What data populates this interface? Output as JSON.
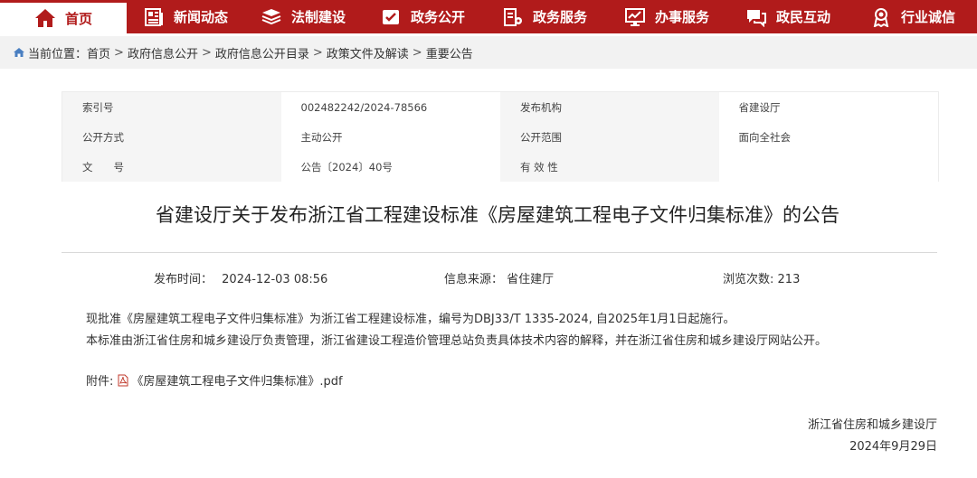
{
  "nav": [
    {
      "label": "首页",
      "icon": "home-icon",
      "active": true
    },
    {
      "label": "新闻动态",
      "icon": "newspaper-icon"
    },
    {
      "label": "法制建设",
      "icon": "layers-icon"
    },
    {
      "label": "政务公开",
      "icon": "document-check-icon"
    },
    {
      "label": "政务服务",
      "icon": "service-icon"
    },
    {
      "label": "办事服务",
      "icon": "monitor-icon"
    },
    {
      "label": "政民互动",
      "icon": "chat-icon"
    },
    {
      "label": "行业诚信",
      "icon": "medal-icon"
    }
  ],
  "breadcrumb": {
    "prefix": "当前位置：",
    "items": [
      "首页",
      "政府信息公开",
      "政府信息公开目录",
      "政策文件及解读",
      "重要公告"
    ],
    "separator": ">"
  },
  "meta": {
    "rows": [
      [
        {
          "label": "索引号",
          "value": "002482242/2024-78566"
        },
        {
          "label": "发布机构",
          "value": "省建设厅"
        }
      ],
      [
        {
          "label": "公开方式",
          "value": "主动公开"
        },
        {
          "label": "公开范围",
          "value": "面向全社会"
        }
      ],
      [
        {
          "label": "文　　号",
          "value": "公告〔2024〕40号"
        },
        {
          "label": "有 效 性",
          "value": ""
        }
      ]
    ]
  },
  "article": {
    "title": "省建设厅关于发布浙江省工程建设标准《房屋建筑工程电子文件归集标准》的公告",
    "publish_time_label": "发布时间：",
    "publish_time": "2024-12-03 08:56",
    "source_label": "信息来源：",
    "source": "省住建厅",
    "views_label": "浏览次数:",
    "views": "213",
    "paragraphs": [
      "现批准《房屋建筑工程电子文件归集标准》为浙江省工程建设标准，编号为DBJ33/T 1335-2024, 自2025年1月1日起施行。",
      "本标准由浙江省住房和城乡建设厅负责管理，浙江省建设工程造价管理总站负责具体技术内容的解释，并在浙江省住房和城乡建设厅网站公开。"
    ],
    "attachment_label": "附件:",
    "attachment_name": "《房屋建筑工程电子文件归集标准》.pdf",
    "signature_org": "浙江省住房和城乡建设厅",
    "signature_date": "2024年9月29日"
  },
  "colors": {
    "brand": "#b11b1b",
    "nav_text": "#ffffff"
  }
}
